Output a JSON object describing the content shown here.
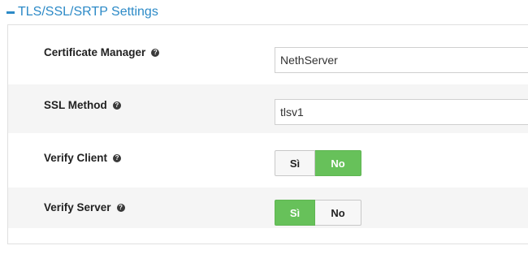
{
  "section": {
    "title": "TLS/SSL/SRTP Settings"
  },
  "fields": {
    "certificate_manager": {
      "label": "Certificate Manager",
      "value": "NethServer"
    },
    "ssl_method": {
      "label": "SSL Method",
      "value": "tlsv1"
    },
    "verify_client": {
      "label": "Verify Client",
      "yes_label": "Sì",
      "no_label": "No",
      "selected": "No"
    },
    "verify_server": {
      "label": "Verify Server",
      "yes_label": "Sì",
      "no_label": "No",
      "selected": "Sì"
    }
  },
  "icons": {
    "collapse": "minus-icon",
    "help": "question-circle-icon"
  },
  "colors": {
    "accent": "#2c8ac7",
    "toggle_active": "#67c15a",
    "row_shade": "#f5f5f5"
  }
}
